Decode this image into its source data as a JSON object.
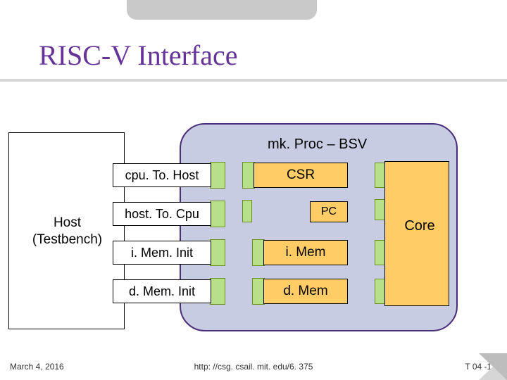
{
  "title": "RISC-V Interface",
  "proc_title": "mk. Proc – BSV",
  "host": {
    "l1": "Host",
    "l2": "(Testbench)"
  },
  "ifaces": {
    "cpuToHost": "cpu. To. Host",
    "hostToCpu": "host. To. Cpu",
    "iMemInit": "i. Mem. Init",
    "dMemInit": "d. Mem. Init"
  },
  "inner": {
    "csr": "CSR",
    "pc": "PC",
    "imem": "i. Mem",
    "dmem": "d. Mem",
    "core": "Core"
  },
  "footer": {
    "date": "March 4, 2016",
    "url": "http: //csg. csail. mit. edu/6. 375",
    "page": "T 04 -11"
  }
}
